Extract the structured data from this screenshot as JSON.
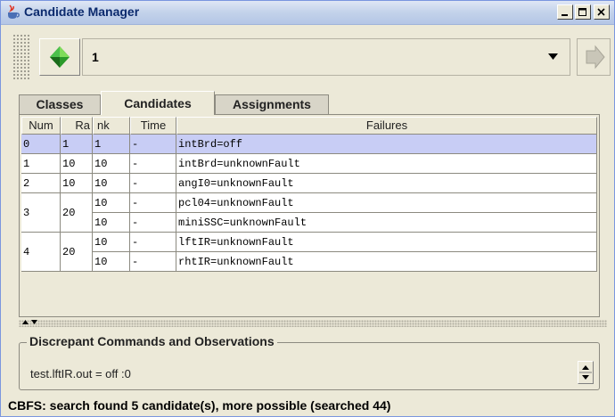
{
  "window": {
    "title": "Candidate Manager"
  },
  "toolbar": {
    "candidate_value": "1"
  },
  "tabs": [
    {
      "label": "Classes",
      "active": false
    },
    {
      "label": "Candidates",
      "active": true
    },
    {
      "label": "Assignments",
      "active": false
    }
  ],
  "table": {
    "headers": [
      "Num",
      "Ra",
      "nk",
      "Time",
      "Failures"
    ],
    "rows": [
      {
        "num": "0",
        "rank": "1",
        "time": "-",
        "failures": [
          {
            "nk": "1",
            "time": "-",
            "failure": "intBrd=off"
          }
        ],
        "selected": true
      },
      {
        "num": "1",
        "rank": "10",
        "time": "-",
        "failures": [
          {
            "nk": "10",
            "time": "-",
            "failure": "intBrd=unknownFault"
          }
        ],
        "selected": false
      },
      {
        "num": "2",
        "rank": "10",
        "time": "-",
        "failures": [
          {
            "nk": "10",
            "time": "-",
            "failure": "angI0=unknownFault"
          }
        ],
        "selected": false
      },
      {
        "num": "3",
        "rank": "20",
        "time": "-",
        "failures": [
          {
            "nk": "10",
            "time": "-",
            "failure": "pcl04=unknownFault"
          },
          {
            "nk": "10",
            "time": "-",
            "failure": "miniSSC=unknownFault"
          }
        ],
        "selected": false
      },
      {
        "num": "4",
        "rank": "20",
        "time": "-",
        "failures": [
          {
            "nk": "10",
            "time": "-",
            "failure": "lftIR=unknownFault"
          },
          {
            "nk": "10",
            "time": "-",
            "failure": "rhtIR=unknownFault"
          }
        ],
        "selected": false
      }
    ]
  },
  "discrepant": {
    "title": "Discrepant Commands and Observations",
    "text": "test.lftIR.out = off :0"
  },
  "status": {
    "text": "CBFS: search found 5 candidate(s), more possible (searched 44)"
  },
  "colors": {
    "selected_row": "#c8cdf5",
    "window_bg": "#ece9d8",
    "title_text": "#0b2a6d"
  },
  "icons": {
    "title": "java-cup-icon",
    "green": "green-gem-icon",
    "next": "right-arrow-icon"
  }
}
